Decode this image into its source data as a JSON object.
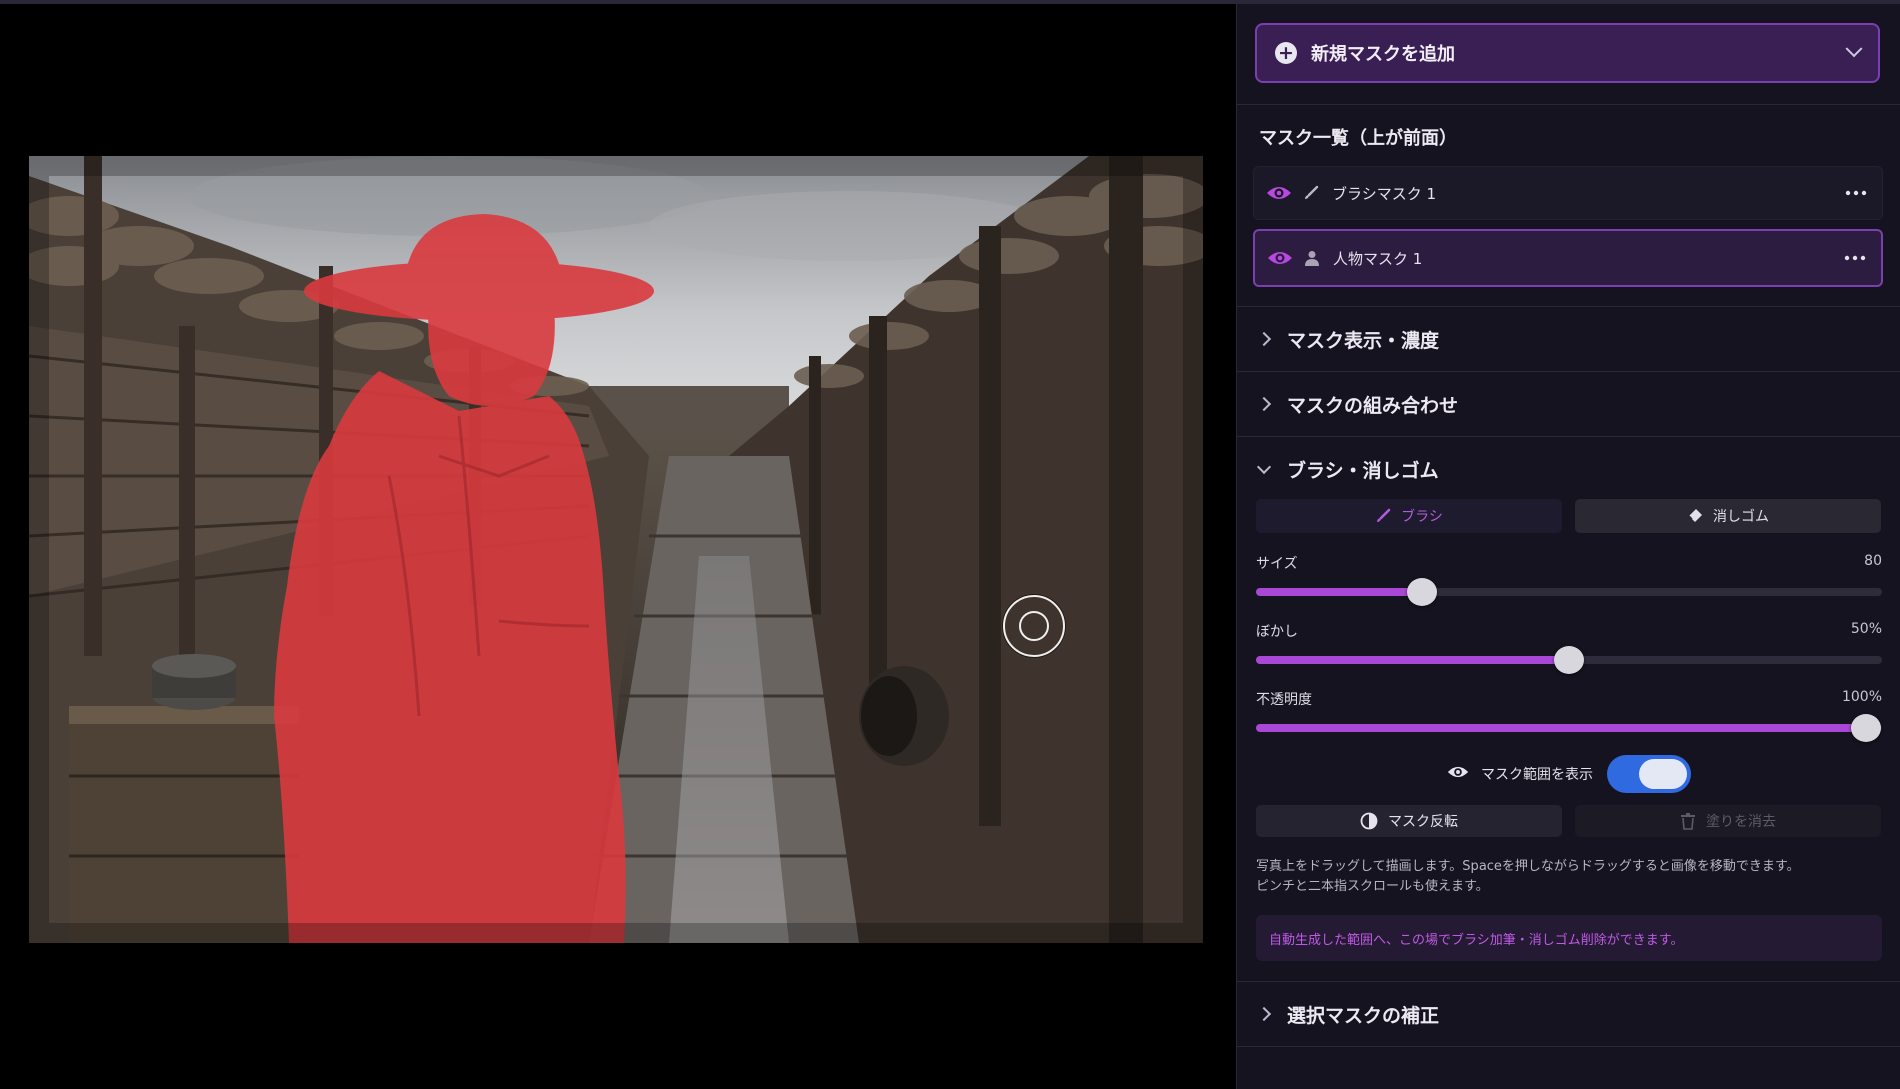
{
  "panel": {
    "add_mask_label": "新規マスクを追加",
    "mask_list_title": "マスク一覧（上が前面）",
    "masks": [
      {
        "name": "ブラシマスク 1",
        "type": "brush",
        "selected": false
      },
      {
        "name": "人物マスク 1",
        "type": "person",
        "selected": true
      }
    ],
    "sections": {
      "display": "マスク表示・濃度",
      "combine": "マスクの組み合わせ",
      "brush": "ブラシ・消しゴム",
      "refine": "選択マスクの補正"
    },
    "tools": {
      "brush": "ブラシ",
      "eraser": "消しゴム",
      "active": "brush"
    },
    "sliders": {
      "size": {
        "label": "サイズ",
        "value": "80",
        "fraction": 0.265
      },
      "blur": {
        "label": "ぼかし",
        "value": "50%",
        "fraction": 0.5
      },
      "opacity": {
        "label": "不透明度",
        "value": "100%",
        "fraction": 0.975
      }
    },
    "show_range": {
      "label": "マスク範囲を表示",
      "on": true
    },
    "actions": {
      "invert": "マスク反転",
      "clear": "塗りを消去"
    },
    "help_line1": "写真上をドラッグして描画します。Spaceを押しながらドラッグすると画像を移動できます。",
    "help_line2": "ピンチと二本指スクロールも使えます。",
    "tip": "自動生成した範囲へ、この場でブラシ加筆・消しゴム削除ができます。"
  },
  "colors": {
    "accent": "#a947d6",
    "mask_overlay": "#d93a3e",
    "toggle_on": "#2f6ae0"
  }
}
